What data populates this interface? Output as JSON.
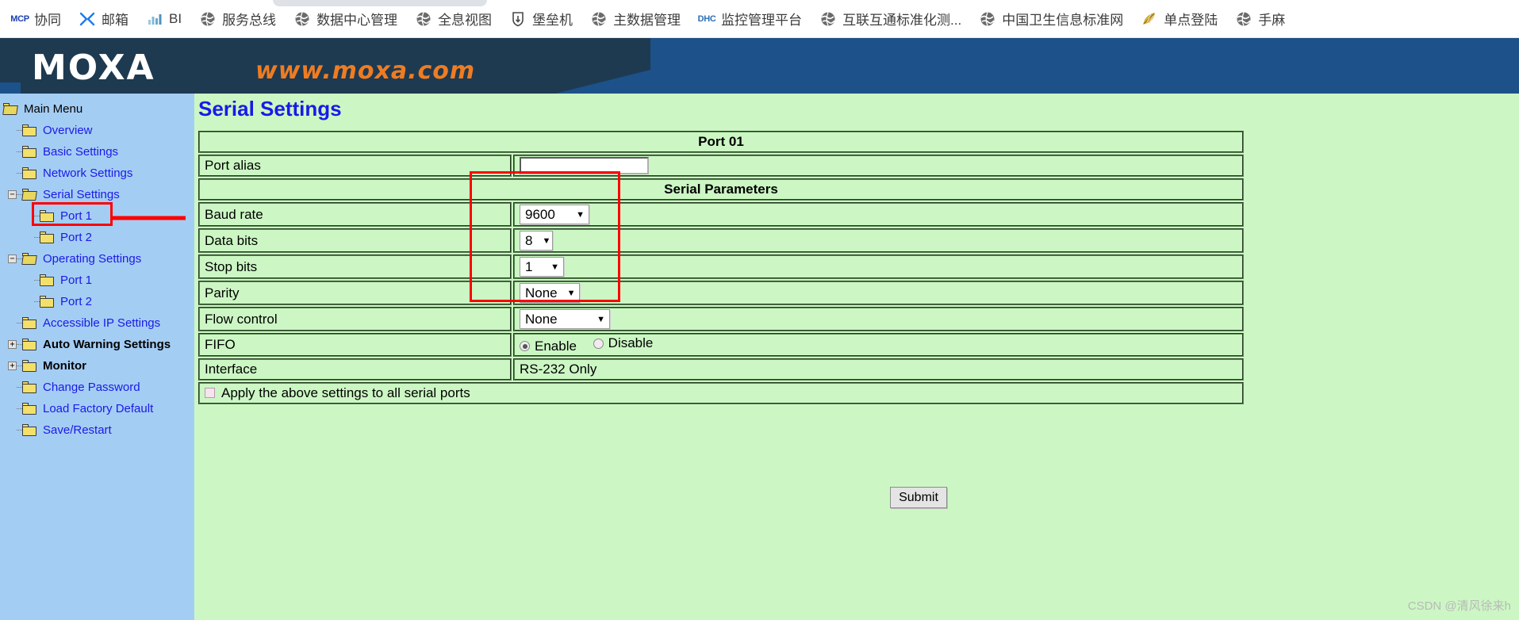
{
  "browser": {
    "bookmarks": [
      {
        "label": "协同",
        "icon": "mcp-text-icon",
        "icon_type": "text",
        "icon_text": "MCP",
        "color": "#1a3fb0"
      },
      {
        "label": "邮箱",
        "icon": "mail-x-icon",
        "icon_type": "x",
        "color": "#1b7ced"
      },
      {
        "label": "BI",
        "icon": "bi-chart-icon",
        "icon_type": "bi",
        "color": "#7fb8d8"
      },
      {
        "label": "服务总线",
        "icon": "globe-icon",
        "icon_type": "globe",
        "color": "#5a5a5a"
      },
      {
        "label": "数据中心管理",
        "icon": "globe-icon",
        "icon_type": "globe",
        "color": "#5a5a5a"
      },
      {
        "label": "全息视图",
        "icon": "globe-icon",
        "icon_type": "globe",
        "color": "#5a5a5a"
      },
      {
        "label": "堡垒机",
        "icon": "shield-icon",
        "icon_type": "shield",
        "color": "#4a4a4a"
      },
      {
        "label": "主数据管理",
        "icon": "globe-icon",
        "icon_type": "globe",
        "color": "#5a5a5a"
      },
      {
        "label": "监控管理平台",
        "icon": "dhc-text-icon",
        "icon_type": "text",
        "icon_text": "DHC",
        "color": "#2d6fb5"
      },
      {
        "label": "互联互通标准化测...",
        "icon": "globe-icon",
        "icon_type": "globe",
        "color": "#5a5a5a"
      },
      {
        "label": "中国卫生信息标准网",
        "icon": "globe-icon",
        "icon_type": "globe",
        "color": "#5a5a5a"
      },
      {
        "label": "单点登陆",
        "icon": "feather-icon",
        "icon_type": "feather",
        "color": "#c9a227"
      },
      {
        "label": "手麻",
        "icon": "globe-icon",
        "icon_type": "globe",
        "color": "#5a5a5a"
      }
    ]
  },
  "banner": {
    "logo_text": "MOXA",
    "url_text": "www.moxa.com",
    "dark_color": "#1e3a51",
    "accent_color": "#1d5189",
    "url_color": "#ef7c22"
  },
  "sidebar": {
    "items": [
      {
        "label": "Main Menu",
        "depth": 0,
        "style": "root",
        "folder": "open",
        "expander": "none"
      },
      {
        "label": "Overview",
        "depth": 1,
        "style": "link",
        "folder": "closed",
        "expander": "none"
      },
      {
        "label": "Basic Settings",
        "depth": 1,
        "style": "link",
        "folder": "closed",
        "expander": "none"
      },
      {
        "label": "Network Settings",
        "depth": 1,
        "style": "link",
        "folder": "closed",
        "expander": "none"
      },
      {
        "label": "Serial Settings",
        "depth": 1,
        "style": "link",
        "folder": "open",
        "expander": "minus"
      },
      {
        "label": "Port 1",
        "depth": 2,
        "style": "link",
        "folder": "closed",
        "expander": "none",
        "selected": true
      },
      {
        "label": "Port 2",
        "depth": 2,
        "style": "link",
        "folder": "closed",
        "expander": "none"
      },
      {
        "label": "Operating Settings",
        "depth": 1,
        "style": "link",
        "folder": "open",
        "expander": "minus"
      },
      {
        "label": "Port 1",
        "depth": 2,
        "style": "link",
        "folder": "closed",
        "expander": "none"
      },
      {
        "label": "Port 2",
        "depth": 2,
        "style": "link",
        "folder": "closed",
        "expander": "none"
      },
      {
        "label": "Accessible IP Settings",
        "depth": 1,
        "style": "link",
        "folder": "closed",
        "expander": "none"
      },
      {
        "label": "Auto Warning Settings",
        "depth": 1,
        "style": "plain",
        "folder": "closed",
        "expander": "plus"
      },
      {
        "label": "Monitor",
        "depth": 1,
        "style": "plain",
        "folder": "closed",
        "expander": "plus"
      },
      {
        "label": "Change Password",
        "depth": 1,
        "style": "link",
        "folder": "closed",
        "expander": "none"
      },
      {
        "label": "Load Factory Default",
        "depth": 1,
        "style": "link",
        "folder": "closed",
        "expander": "none"
      },
      {
        "label": "Save/Restart",
        "depth": 1,
        "style": "link",
        "folder": "closed",
        "expander": "none"
      }
    ]
  },
  "main": {
    "title": "Serial Settings",
    "port_header": "Port 01",
    "params_header": "Serial Parameters",
    "rows": {
      "port_alias_label": "Port alias",
      "port_alias_value": "",
      "baud_rate_label": "Baud rate",
      "baud_rate_value": "9600",
      "data_bits_label": "Data bits",
      "data_bits_value": "8",
      "stop_bits_label": "Stop bits",
      "stop_bits_value": "1",
      "parity_label": "Parity",
      "parity_value": "None",
      "flow_control_label": "Flow control",
      "flow_control_value": "None",
      "fifo_label": "FIFO",
      "fifo_enable_label": "Enable",
      "fifo_disable_label": "Disable",
      "fifo_selected": "Enable",
      "interface_label": "Interface",
      "interface_value": "RS-232 Only",
      "apply_all_label": "Apply the above settings to all serial ports",
      "apply_all_checked": false
    },
    "submit_label": "Submit",
    "watermark": "CSDN @清风徐来h",
    "accent_color": "#1a1ae6",
    "page_bg": "#ccf7c4",
    "annotation_color": "#ff0000"
  }
}
